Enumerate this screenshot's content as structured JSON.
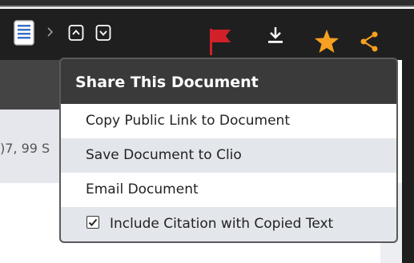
{
  "popup": {
    "title": "Share This Document",
    "items": [
      {
        "label": "Copy Public Link to Document"
      },
      {
        "label": "Save Document to Clio"
      },
      {
        "label": "Email Document"
      },
      {
        "label": "Include Citation with Copied Text",
        "checked": true
      }
    ]
  },
  "background": {
    "partial_text": ")7, 99 S"
  },
  "toolbar": {
    "icons": [
      "document-icon",
      "chevron-right-icon",
      "chevron-up-box-icon",
      "chevron-down-box-icon",
      "flag-icon",
      "download-icon",
      "star-icon",
      "share-icon"
    ]
  },
  "colors": {
    "flag": "#d0202a",
    "star": "#f5a020",
    "share": "#f5a020",
    "popup_header": "#3a3a3a",
    "row_alt": "#e3e6eb"
  }
}
